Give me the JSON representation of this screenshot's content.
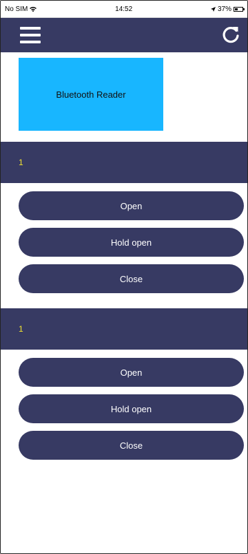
{
  "status_bar": {
    "carrier": "No SIM",
    "time": "14:52",
    "battery": "37%"
  },
  "reader": {
    "label": "Bluetooth Reader"
  },
  "doors": [
    {
      "name": "1",
      "actions": {
        "open": "Open",
        "hold_open": "Hold open",
        "close": "Close"
      }
    },
    {
      "name": "1",
      "actions": {
        "open": "Open",
        "hold_open": "Hold open",
        "close": "Close"
      }
    }
  ],
  "icons": {
    "menu": "hamburger-menu-icon",
    "refresh": "refresh-icon",
    "wifi": "wifi-icon",
    "location": "location-arrow-icon",
    "battery": "battery-icon"
  },
  "colors": {
    "bar": "#373a63",
    "reader_tile": "#18b6ff",
    "door_label": "#f3e431"
  }
}
